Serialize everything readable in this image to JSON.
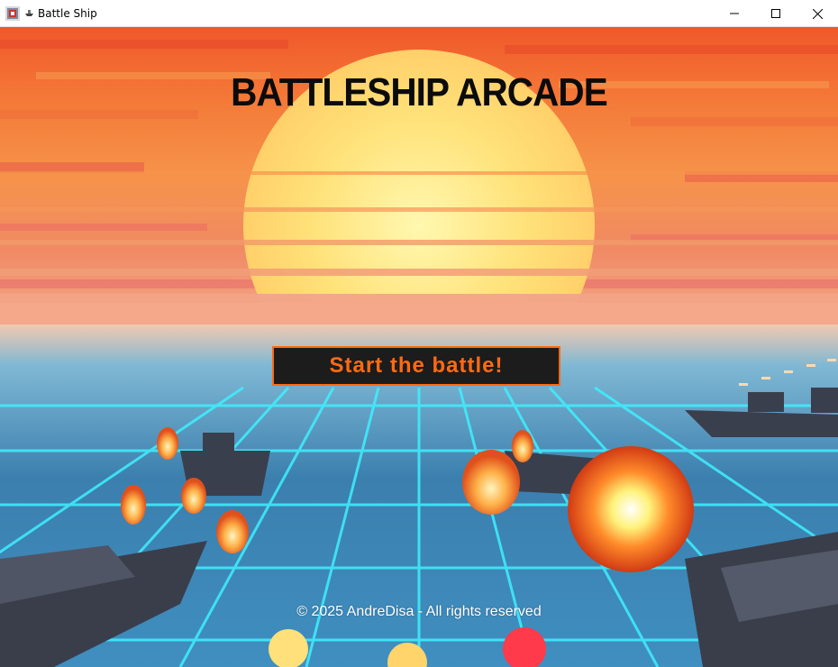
{
  "window": {
    "title": "Battle Ship",
    "controls": {
      "minimize": "minimize-icon",
      "maximize": "maximize-icon",
      "close": "close-icon"
    }
  },
  "game": {
    "title": "BATTLESHIP ARCADE",
    "start_label": "Start the battle!",
    "copyright": "© 2025 AndreDisa - All rights reserved"
  },
  "colors": {
    "button_bg": "#1c1c1c",
    "button_accent": "#ff6a13",
    "grid_cyan": "#33e8ff",
    "sky_top": "#f25c2a",
    "sun": "#ffe77a"
  }
}
